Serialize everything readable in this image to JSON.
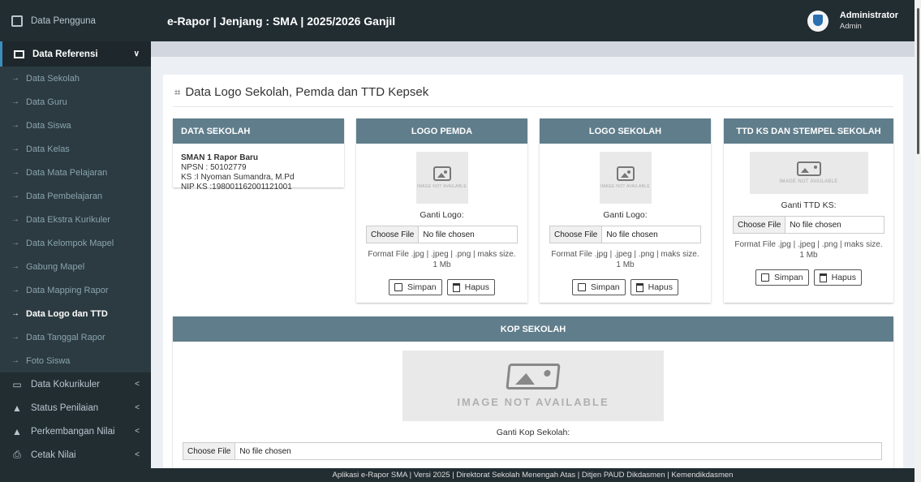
{
  "sidebar": {
    "top_item": "Data Pengguna",
    "active_menu": "Data Referensi",
    "sub_items": [
      {
        "label": "Data Sekolah"
      },
      {
        "label": "Data Guru"
      },
      {
        "label": "Data Siswa"
      },
      {
        "label": "Data Kelas"
      },
      {
        "label": "Data Mata Pelajaran"
      },
      {
        "label": "Data Pembelajaran"
      },
      {
        "label": "Data Ekstra Kurikuler"
      },
      {
        "label": "Data Kelompok Mapel"
      },
      {
        "label": "Gabung Mapel"
      },
      {
        "label": "Data Mapping Rapor"
      },
      {
        "label": "Data Logo dan TTD"
      },
      {
        "label": "Data Tanggal Rapor"
      },
      {
        "label": "Foto Siswa"
      }
    ],
    "menu_items": [
      {
        "label": "Data Kokurikuler",
        "icon": "document-icon"
      },
      {
        "label": "Status Penilaian",
        "icon": "graduation-cap-icon"
      },
      {
        "label": "Perkembangan Nilai",
        "icon": "graduation-cap-icon"
      },
      {
        "label": "Cetak Nilai",
        "icon": "print-icon"
      }
    ]
  },
  "header": {
    "title": "e-Rapor | Jenjang : SMA | 2025/2026 Ganjil",
    "user_name": "Administrator",
    "user_role": "Admin"
  },
  "page": {
    "title": "Data Logo Sekolah, Pemda dan TTD Kepsek"
  },
  "school": {
    "header": "DATA SEKOLAH",
    "name": "SMAN 1 Rapor Baru",
    "npsn": "NPSN : 50102779",
    "ks": "KS :I Nyoman Sumandra, M.Pd",
    "nip": "NIP KS :198001162001121001"
  },
  "logo_pemda": {
    "header": "LOGO PEMDA",
    "na_text": "IMAGE NOT AVAILABLE",
    "ganti": "Ganti Logo:",
    "choose": "Choose File",
    "nofile": "No file chosen",
    "format": "Format File .jpg | .jpeg | .png | maks size. 1 Mb",
    "simpan": "Simpan",
    "hapus": "Hapus"
  },
  "logo_sekolah": {
    "header": "LOGO SEKOLAH",
    "na_text": "IMAGE NOT AVAILABLE",
    "ganti": "Ganti Logo:",
    "choose": "Choose File",
    "nofile": "No file chosen",
    "format": "Format File .jpg | .jpeg | .png | maks size. 1 Mb",
    "simpan": "Simpan",
    "hapus": "Hapus"
  },
  "ttd": {
    "header": "TTD KS DAN STEMPEL SEKOLAH",
    "na_text": "IMAGE NOT AVAILABLE",
    "ganti": "Ganti TTD KS:",
    "choose": "Choose File",
    "nofile": "No file chosen",
    "format": "Format File .jpg | .jpeg | .png | maks size. 1 Mb",
    "simpan": "Simpan",
    "hapus": "Hapus"
  },
  "kop": {
    "header": "KOP SEKOLAH",
    "na_text": "IMAGE NOT AVAILABLE",
    "ganti": "Ganti Kop Sekolah:",
    "choose": "Choose File",
    "nofile": "No file chosen"
  },
  "footer": {
    "text": "Aplikasi e-Rapor SMA | Versi 2025 | Direktorat Sekolah Menengah Atas | Ditjen PAUD Dikdasmen | Kemendikdasmen"
  }
}
